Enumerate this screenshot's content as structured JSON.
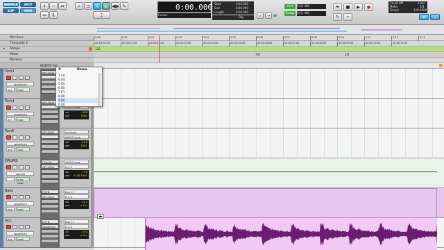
{
  "toolbar": {
    "modes": [
      "SHUFFLE",
      "SPOT",
      "SLIP",
      "GRID"
    ],
    "tools": [
      "zoom-icon",
      "trim-icon",
      "selector-icon",
      "grabber-icon",
      "scrubber-icon",
      "pencil-icon",
      "smart-tool-icon"
    ],
    "counter_main": "0:00.000",
    "counter_cursor_label": "Cursor",
    "sel_labels": [
      "Start",
      "End",
      "Length"
    ],
    "sel_values": [
      "0:00.000",
      "0:00.000",
      "0:00.000"
    ],
    "nudge_grid_values": [
      "0| 0| 480",
      "0| 0| 480"
    ],
    "grid_label": "Grid",
    "nudge_label": "Nudge",
    "count_off": "Count Off",
    "meter_label": "Meter",
    "tempo_label": "Tempo",
    "meter_value": "4/4",
    "tempo_value": "120.0000",
    "bar_value": "1 bar",
    "dly_label": "Dly",
    "num80": "80"
  },
  "rulers": {
    "minsecs": "Min:Secs",
    "timecode": "Timecode 2",
    "tempo": "Tempo",
    "meter": "Meter",
    "markers": "Markers",
    "tempo_value": "120",
    "meter_values": [
      "7/8",
      "4/4"
    ],
    "minsec_ticks": [
      "0:00",
      "0:01",
      "0:02",
      "0:03",
      "0:04",
      "0:05",
      "0:06",
      "0:07",
      "0:08",
      "0:09",
      "0:10",
      "0:11",
      "0:12"
    ],
    "tc_ticks": [
      "00:00:00:00",
      "00:00:01:00",
      "00:00:02:00",
      "00:00:03:00",
      "00:00:04:00",
      "00:00:05:00",
      "00:00:06:00",
      "00:00:07:00",
      "00:00:08:00",
      "00:00:09:00",
      "00:00:10:00",
      "00:00:11:00"
    ]
  },
  "columns": {
    "inserts": "INSERTS A-E",
    "io": "I/O",
    "name": "Name"
  },
  "insert_menu": {
    "header_num": "#",
    "header_name": "Name",
    "items": [
      "3   (3)",
      "4   (4)",
      "5   (5)",
      "6   (6)",
      "7   (7)",
      "8   (8)",
      "9   (9)",
      "0   (0)"
    ]
  },
  "tracks": [
    {
      "name": "Tom3",
      "view": "waveform",
      "dyn": "dyn",
      "read": "read",
      "plugins": [
        "API-2500",
        ""
      ],
      "io": [
        "",
        "AUX Drums"
      ],
      "vol": "-14.8",
      "pan": "100>"
    },
    {
      "name": "Tom4",
      "view": "waveform",
      "dyn": "dyn",
      "read": "read",
      "plugins": [
        "API-2500",
        ""
      ],
      "io": [
        "",
        "AUX Drums"
      ],
      "vol": "-18.8",
      "pan": "100>"
    },
    {
      "name": "Tom5",
      "view": "waveform",
      "dyn": "dyn",
      "read": "read",
      "plugins": [
        "API-2500",
        ""
      ],
      "io": [
        "no input",
        "AUX Drums"
      ],
      "vol": "-14.8",
      "pan": "100>"
    },
    {
      "name": "DRUMS",
      "view": "volume",
      "dyn": "",
      "read": "auto read",
      "plugins": [
        "CLA-2A",
        "API-550A"
      ],
      "io": [
        "AUX Drums",
        "A 1-2"
      ],
      "vol": "-7.9",
      "pan": "<100 100>"
    },
    {
      "name": "Bass",
      "view": "waveform",
      "dyn": "dyn",
      "read": "read",
      "plugins": [
        "EQ7B",
        "API-2500"
      ],
      "io": [
        "Bus 17",
        "A 1-2"
      ],
      "vol": "-11.1",
      "pan": "< 0 >"
    },
    {
      "name": "GCL",
      "view": "waveform",
      "dyn": "dyn",
      "read": "read",
      "plugins": [
        "EQ7B",
        "DbgVerb3"
      ],
      "io": [
        "Bus 17",
        "A 1-2"
      ],
      "vol": "-19.0",
      "pan": "< 0 >"
    }
  ],
  "colors": {
    "bass_lane": "#e7c7f0",
    "gcl_lane": "#f1c9f5",
    "waveform": "#6b1d72",
    "drums_lane": "#eaf3ea"
  }
}
